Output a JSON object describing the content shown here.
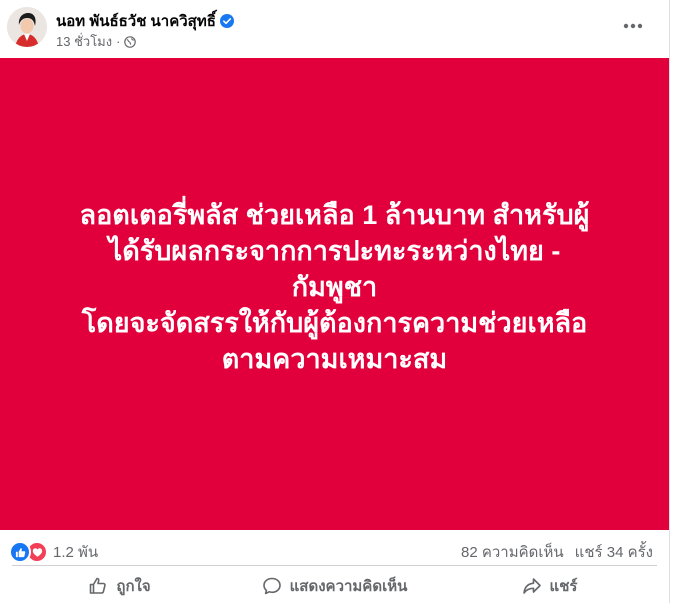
{
  "post": {
    "author": "นอท พันธ์ธวัช นาควิสุทธิ์",
    "timestamp": "13 ชั่วโมง",
    "separator": "·",
    "banner_color": "#e1003c",
    "banner_lines": [
      "ลอตเตอรี่พลัส ช่วยเหลือ 1 ล้านบาท สำหรับผู้",
      "ได้รับผลกระจากการปะทะระหว่างไทย -",
      "กัมพูชา",
      "โดยจะจัดสรรให้กับผู้ต้องการความช่วยเหลือ",
      "ตามความเหมาะสม"
    ]
  },
  "stats": {
    "reactions_count": "1.2 พัน",
    "comments": "82 ความคิดเห็น",
    "shares": "แชร์ 34 ครั้ง"
  },
  "actions": {
    "like": "ถูกใจ",
    "comment": "แสดงความคิดเห็น",
    "share": "แชร์"
  },
  "icons": {
    "verified": "verified-badge-icon",
    "globe": "globe-icon",
    "more": "more-options-icon",
    "like_reaction": "like-reaction-icon",
    "love_reaction": "love-reaction-icon",
    "like_action": "thumbs-up-icon",
    "comment_action": "comment-bubble-icon",
    "share_action": "share-arrow-icon"
  },
  "colors": {
    "brand_blue": "#1877f2",
    "love_red": "#f33e58",
    "secondary_text": "#65676b"
  }
}
